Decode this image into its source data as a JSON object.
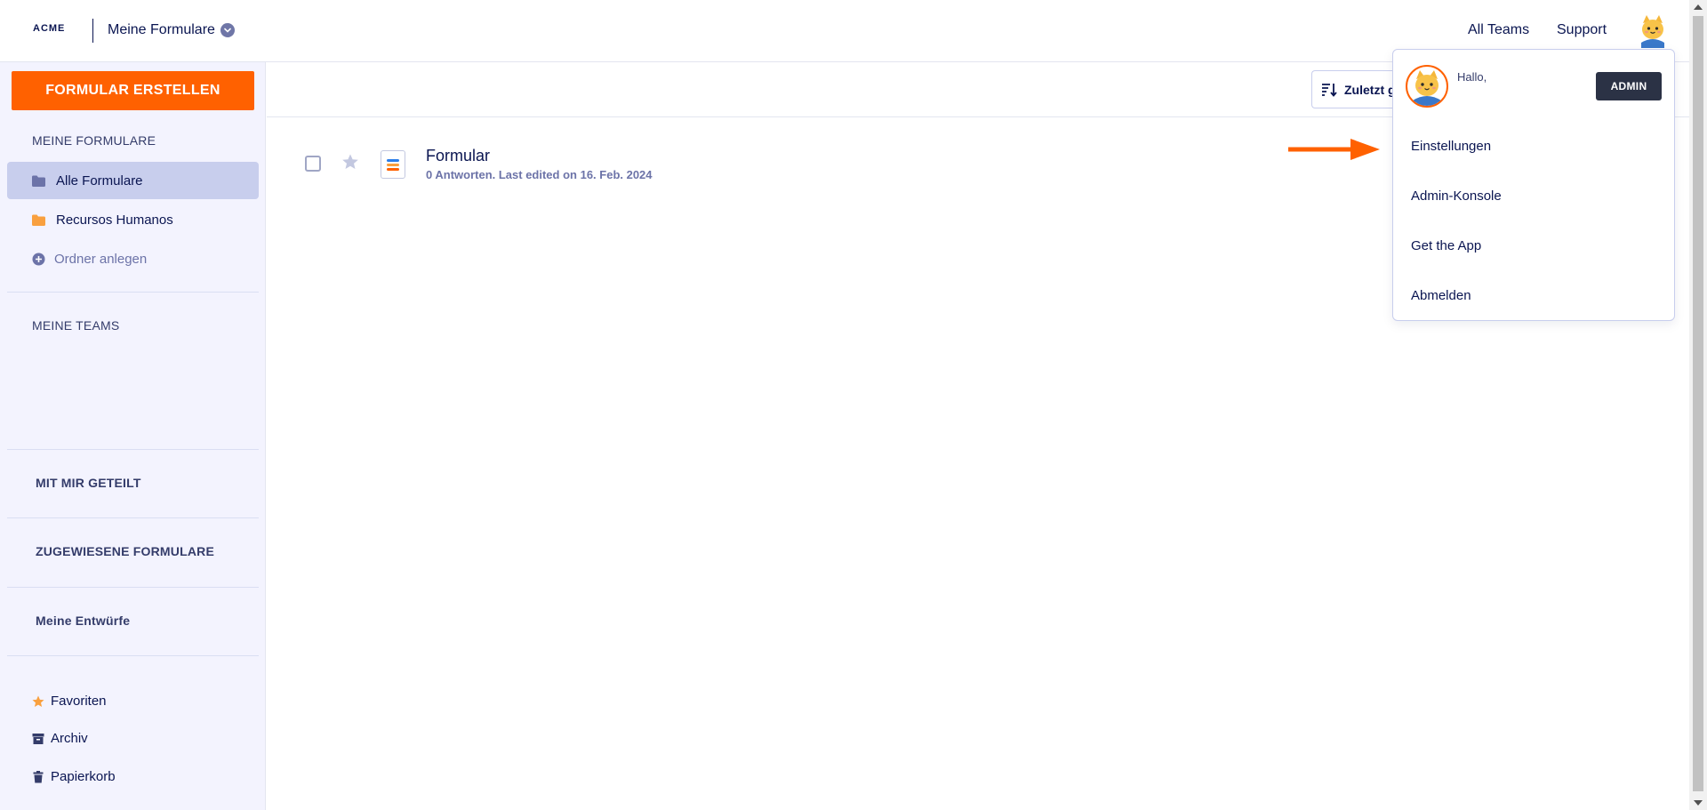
{
  "header": {
    "logo": "ACME",
    "title": "Meine Formulare",
    "nav": {
      "teams": "All Teams",
      "support": "Support"
    }
  },
  "sidebar": {
    "create_button": "FORMULAR ERSTELLEN",
    "my_forms_title": "MEINE FORMULARE",
    "items": [
      {
        "label": "Alle Formulare",
        "icon": "folder-icon",
        "active": true
      },
      {
        "label": "Recursos Humanos",
        "icon": "folder-icon",
        "active": false
      },
      {
        "label": "Ordner anlegen",
        "icon": "plus-circle-icon",
        "active": false
      }
    ],
    "my_teams_title": "MEINE TEAMS",
    "shared_title": "MIT MIR GETEILT",
    "assigned_title": "ZUGEWIESENE FORMULARE",
    "drafts_title": "Meine Entwürfe",
    "footer": [
      {
        "label": "Favoriten",
        "icon": "star-icon"
      },
      {
        "label": "Archiv",
        "icon": "archive-icon"
      },
      {
        "label": "Papierkorb",
        "icon": "trash-icon"
      }
    ]
  },
  "toolbar": {
    "sort_label": "Zuletzt g"
  },
  "forms": [
    {
      "name": "Formular",
      "meta": "0 Antworten. Last edited on 16. Feb. 2024"
    }
  ],
  "dropdown": {
    "greeting": "Hallo,",
    "badge": "ADMIN",
    "items": [
      "Einstellungen",
      "Admin-Konsole",
      "Get the App",
      "Abmelden"
    ]
  },
  "colors": {
    "accent": "#ff6100",
    "navy": "#0a1551",
    "sidebar_bg": "#f3f3fe",
    "active_bg": "#c8ceed",
    "badge_bg": "#2b3245"
  }
}
